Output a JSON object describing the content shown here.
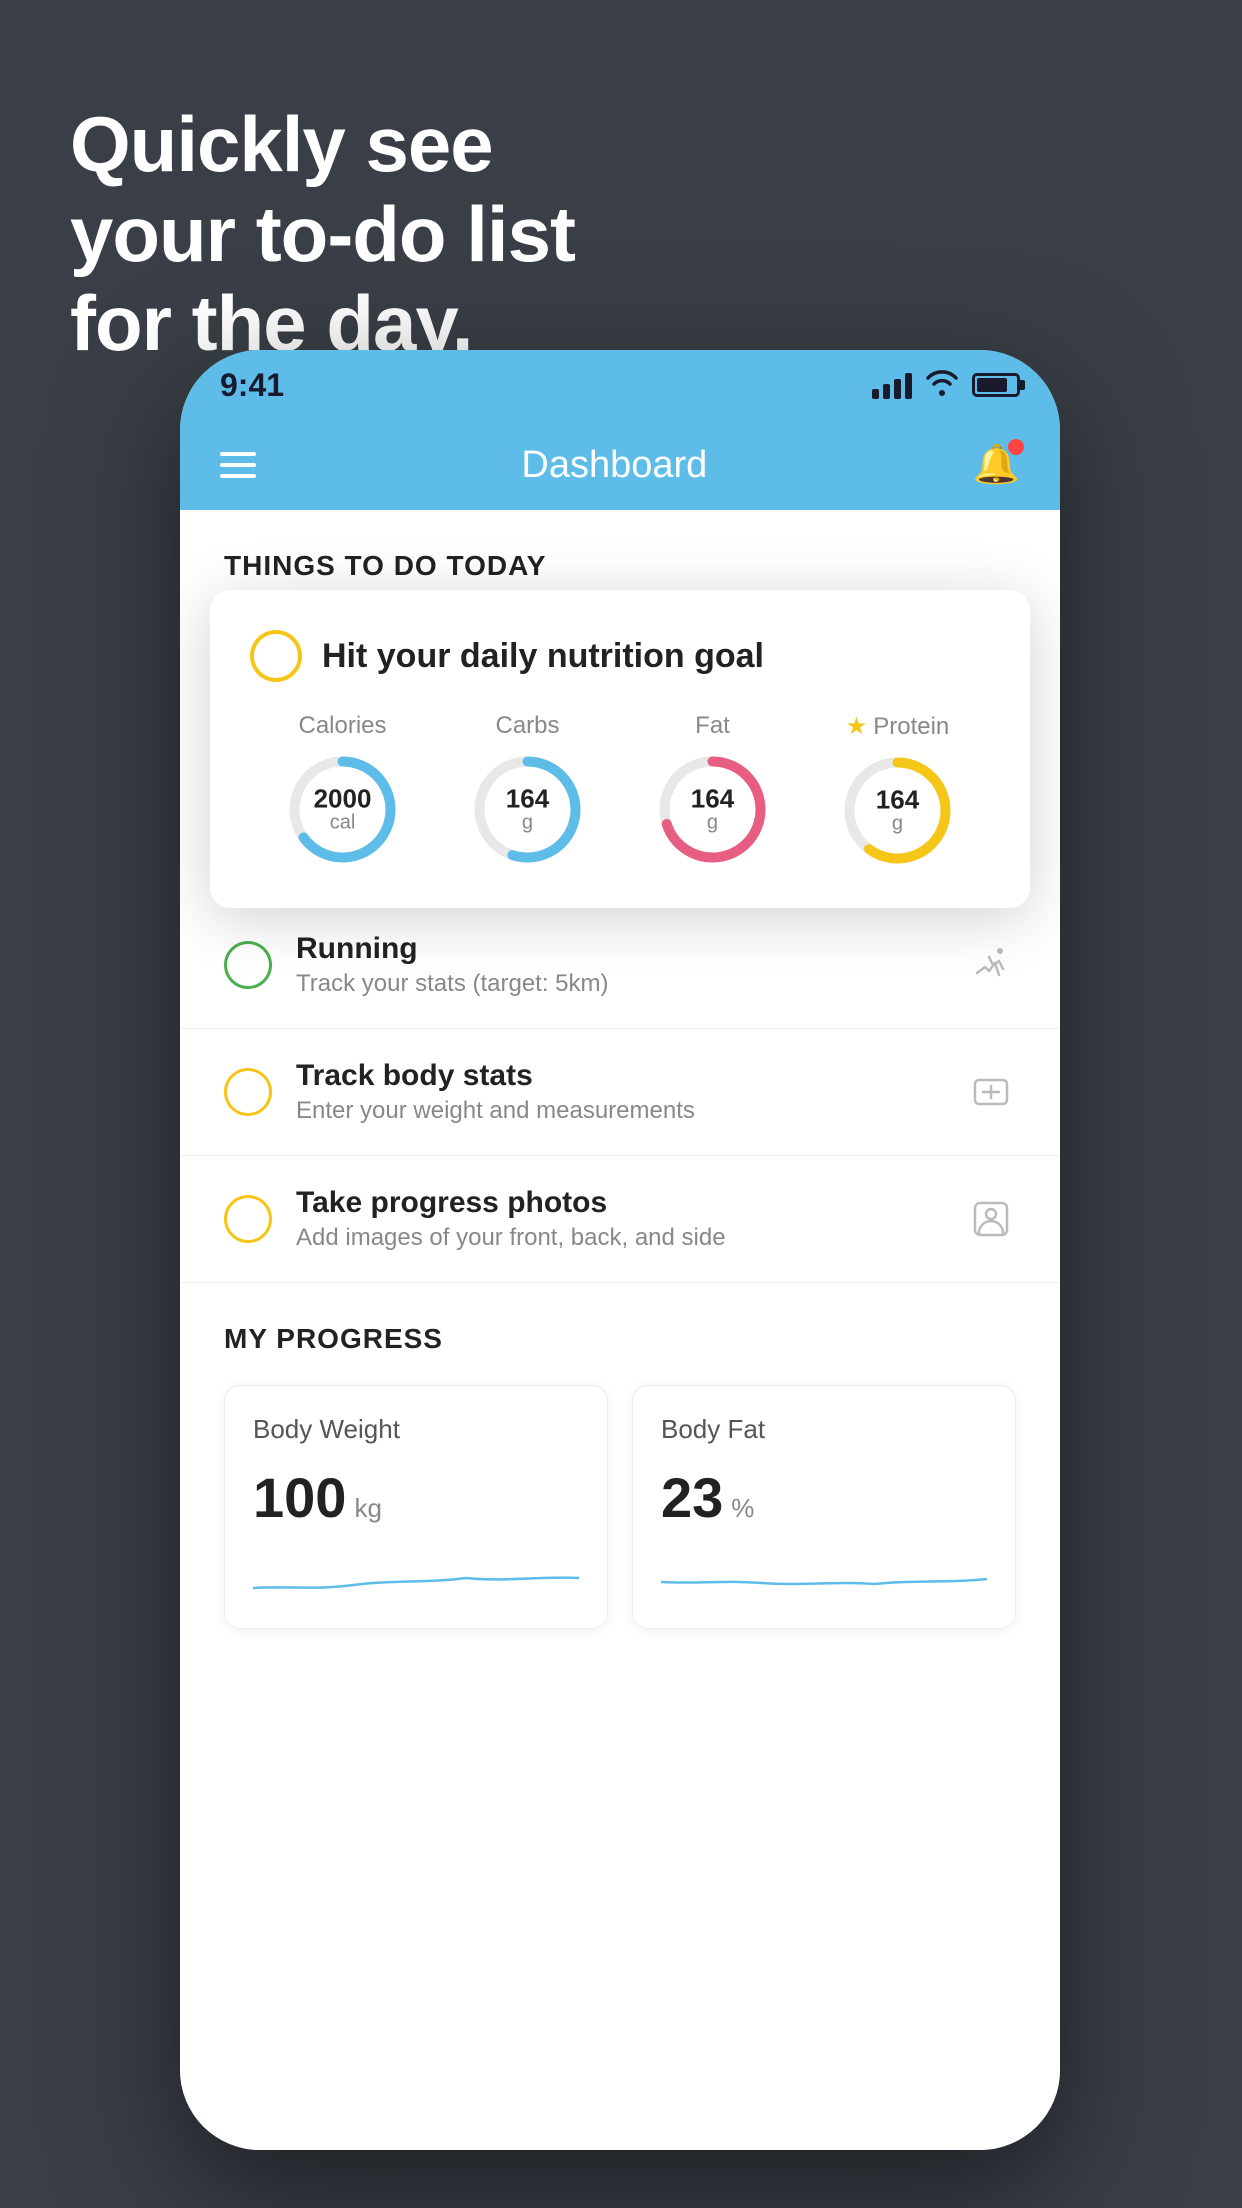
{
  "background_color": "#3a3f47",
  "headline": {
    "line1": "Quickly see",
    "line2": "your to-do list",
    "line3": "for the day.",
    "full": "Quickly see\nyour to-do list\nfor the day."
  },
  "status_bar": {
    "time": "9:41"
  },
  "header": {
    "title": "Dashboard"
  },
  "sections": {
    "things_to_do": {
      "label": "THINGS TO DO TODAY"
    },
    "my_progress": {
      "label": "MY PROGRESS"
    }
  },
  "floating_card": {
    "title": "Hit your daily nutrition goal",
    "items": [
      {
        "label": "Calories",
        "value": "2000",
        "unit": "cal",
        "color": "#5dbde8",
        "progress": 0.65
      },
      {
        "label": "Carbs",
        "value": "164",
        "unit": "g",
        "color": "#5dbde8",
        "progress": 0.55
      },
      {
        "label": "Fat",
        "value": "164",
        "unit": "g",
        "color": "#e85d82",
        "progress": 0.7
      },
      {
        "label": "Protein",
        "value": "164",
        "unit": "g",
        "color": "#f5c518",
        "starred": true,
        "progress": 0.6
      }
    ]
  },
  "tasks": [
    {
      "name": "Running",
      "sub": "Track your stats (target: 5km)",
      "circle_color": "green",
      "icon": "shoe"
    },
    {
      "name": "Track body stats",
      "sub": "Enter your weight and measurements",
      "circle_color": "yellow",
      "icon": "scale"
    },
    {
      "name": "Take progress photos",
      "sub": "Add images of your front, back, and side",
      "circle_color": "yellow2",
      "icon": "person"
    }
  ],
  "progress_cards": [
    {
      "title": "Body Weight",
      "value": "100",
      "unit": "kg"
    },
    {
      "title": "Body Fat",
      "value": "23",
      "unit": "%"
    }
  ]
}
